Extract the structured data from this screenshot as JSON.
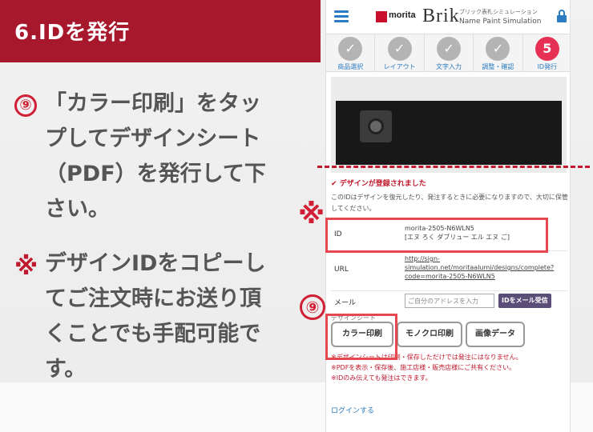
{
  "slide": {
    "title": "6.IDを発行",
    "step_marker": "⑨",
    "instruction_lines": [
      "「カラー印刷」をタッ",
      "プしてデザインシート",
      "（PDF）を発行して下",
      "さい。"
    ],
    "note_marker": "※",
    "note_lines": [
      "デザインIDをコピーし",
      "てご注文時にお送り頂",
      "くことでも手配可能で",
      "す。"
    ],
    "callout_asterisk": "※",
    "callout_nine": "⑨"
  },
  "app": {
    "logo_text": "morita",
    "brand": "Brik",
    "subtitle_jp": "ブリック表札シミュレーション",
    "subtitle_en": "Name Paint Simulation",
    "steps": [
      {
        "label": "商品選択",
        "mark": "✓",
        "active": false
      },
      {
        "label": "レイアウト",
        "mark": "✓",
        "active": false
      },
      {
        "label": "文字入力",
        "mark": "✓",
        "active": false
      },
      {
        "label": "調整・確認",
        "mark": "✓",
        "active": false
      },
      {
        "label": "ID発行",
        "mark": "5",
        "active": true
      }
    ],
    "alert_title": "デザインが登録されました",
    "alert_body": "このIDはデザインを復元したり、発注するときに必要になりますので、大切に保管してください。",
    "id_label": "ID",
    "id_value": "morita-2505-N6WLN5",
    "id_reading": "[エヌ ろく ダブリュー エル エヌ ご]",
    "url_label": "URL",
    "url_lines": [
      "http://sign-",
      "simulation.net/moritaalumi/designs/complete?",
      "code=morita-2505-N6WLN5"
    ],
    "mail_label": "メール",
    "mail_placeholder": "ご自分のアドレスを入力",
    "mail_button": "IDをメール受信",
    "sheet_label": "デザインシート",
    "buttons": [
      "カラー印刷",
      "モノクロ印刷",
      "画像データ"
    ],
    "notes": [
      "※デザインシートは印刷・保存しただけでは発注にはなりません。",
      "※PDFを表示・保存後、施工店様・販売店様にご共有ください。",
      "※IDのみ伝えても発注はできます。"
    ],
    "login": "ログインする"
  },
  "colors": {
    "accent": "#a8182c",
    "highlight": "#e5484f",
    "step_active": "#e63155",
    "link": "#2b7cc2"
  }
}
